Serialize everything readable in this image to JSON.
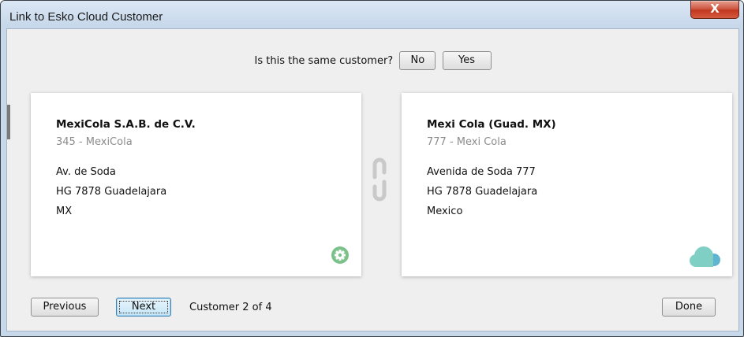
{
  "window": {
    "title": "Link to Esko Cloud Customer",
    "close_label": "X"
  },
  "question": {
    "text": "Is this the same customer?",
    "no_label": "No",
    "yes_label": "Yes"
  },
  "local_customer": {
    "name": "MexiCola S.A.B. de C.V.",
    "code": "345 - MexiCola",
    "address": [
      "Av. de Soda",
      "HG 7878 Guadelajara",
      "MX"
    ],
    "badge_icon": "gear-icon"
  },
  "cloud_customer": {
    "name": "Mexi Cola (Guad. MX)",
    "code": "777 - Mexi Cola",
    "address": [
      "Avenida de Soda 777",
      "HG 7878 Guadelajara",
      "Mexico"
    ],
    "badge_icon": "cloud-icon"
  },
  "navigation": {
    "previous_label": "Previous",
    "next_label": "Next",
    "counter_text": "Customer 2 of 4",
    "done_label": "Done"
  },
  "colors": {
    "window_frame": "#c7d8ea",
    "close_button": "#c2381f",
    "gear_badge": "#7cc08a",
    "cloud_badge": "#7fcfc4",
    "link_icon": "#c9c9c9"
  }
}
